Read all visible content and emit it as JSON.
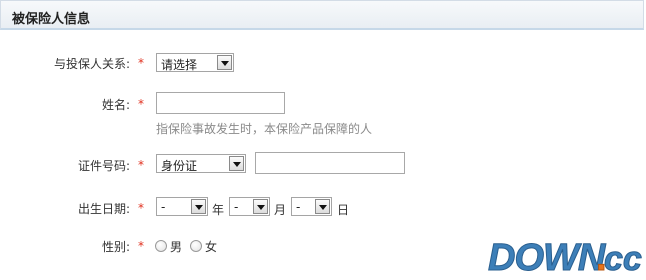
{
  "header": {
    "title": "被保险人信息"
  },
  "form": {
    "relation": {
      "label": "与投保人关系:",
      "required_mark": "*",
      "selected": "请选择"
    },
    "name": {
      "label": "姓名:",
      "required_mark": "*",
      "value": "",
      "hint": "指保险事故发生时，本保险产品保障的人"
    },
    "id": {
      "label": "证件号码:",
      "required_mark": "*",
      "type_selected": "身份证",
      "number_value": ""
    },
    "birth": {
      "label": "出生日期:",
      "required_mark": "*",
      "year_selected": "-",
      "year_unit": "年",
      "month_selected": "-",
      "month_unit": "月",
      "day_selected": "-",
      "day_unit": "日"
    },
    "gender": {
      "label": "性别:",
      "required_mark": "*",
      "male": "男",
      "female": "女"
    }
  },
  "watermark": {
    "text": "DOWN.cc",
    "colors": {
      "main": "#3d7fb8",
      "accent": "#e8741c"
    }
  },
  "colors": {
    "required": "#e0301e",
    "hint": "#8a8a8a"
  }
}
